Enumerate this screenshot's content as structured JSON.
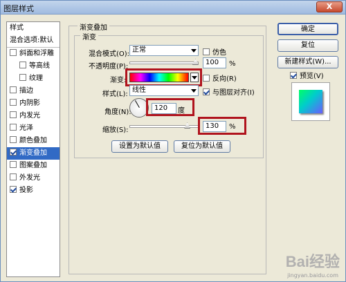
{
  "window": {
    "title": "图层样式",
    "close_label": "X"
  },
  "sidebar": {
    "items": [
      {
        "label": "样式",
        "kind": "header",
        "checkbox": false
      },
      {
        "label": "混合选项:默认",
        "kind": "header2",
        "checkbox": false
      },
      {
        "label": "斜面和浮雕",
        "kind": "top",
        "checkbox": true,
        "checked": false
      },
      {
        "label": "等高线",
        "kind": "sub",
        "checkbox": true,
        "checked": false
      },
      {
        "label": "纹理",
        "kind": "sub",
        "checkbox": true,
        "checked": false
      },
      {
        "label": "描边",
        "kind": "top",
        "checkbox": true,
        "checked": false
      },
      {
        "label": "内阴影",
        "kind": "top",
        "checkbox": true,
        "checked": false
      },
      {
        "label": "内发光",
        "kind": "top",
        "checkbox": true,
        "checked": false
      },
      {
        "label": "光泽",
        "kind": "top",
        "checkbox": true,
        "checked": false
      },
      {
        "label": "颜色叠加",
        "kind": "top",
        "checkbox": true,
        "checked": false
      },
      {
        "label": "渐变叠加",
        "kind": "top",
        "checkbox": true,
        "checked": true,
        "selected": true
      },
      {
        "label": "图案叠加",
        "kind": "top",
        "checkbox": true,
        "checked": false
      },
      {
        "label": "外发光",
        "kind": "top",
        "checkbox": true,
        "checked": false
      },
      {
        "label": "投影",
        "kind": "top",
        "checkbox": true,
        "checked": true
      }
    ]
  },
  "panel": {
    "section_title": "渐变叠加",
    "group_title": "渐变",
    "blend_mode_label": "混合模式(O):",
    "blend_mode_value": "正常",
    "dither_label": "仿色",
    "opacity_label": "不透明度(P):",
    "opacity_value": "100",
    "percent": "%",
    "gradient_label": "渐变:",
    "reverse_label": "反向(R)",
    "style_label": "样式(L):",
    "style_value": "线性",
    "align_label": "与图层对齐(I)",
    "angle_label": "角度(N):",
    "angle_value": "120",
    "degree_unit": "度",
    "scale_label": "缩放(S):",
    "scale_value": "130",
    "make_default": "设置为默认值",
    "reset_default": "复位为默认值",
    "opacity_level": 1.0,
    "scale_level": 0.87
  },
  "actions": {
    "ok": "确定",
    "reset": "复位",
    "new_style": "新建样式(W)...",
    "preview_label": "预览(V)"
  },
  "watermark": {
    "main": "Bai经验",
    "sub": "jingyan.baidu.com"
  }
}
